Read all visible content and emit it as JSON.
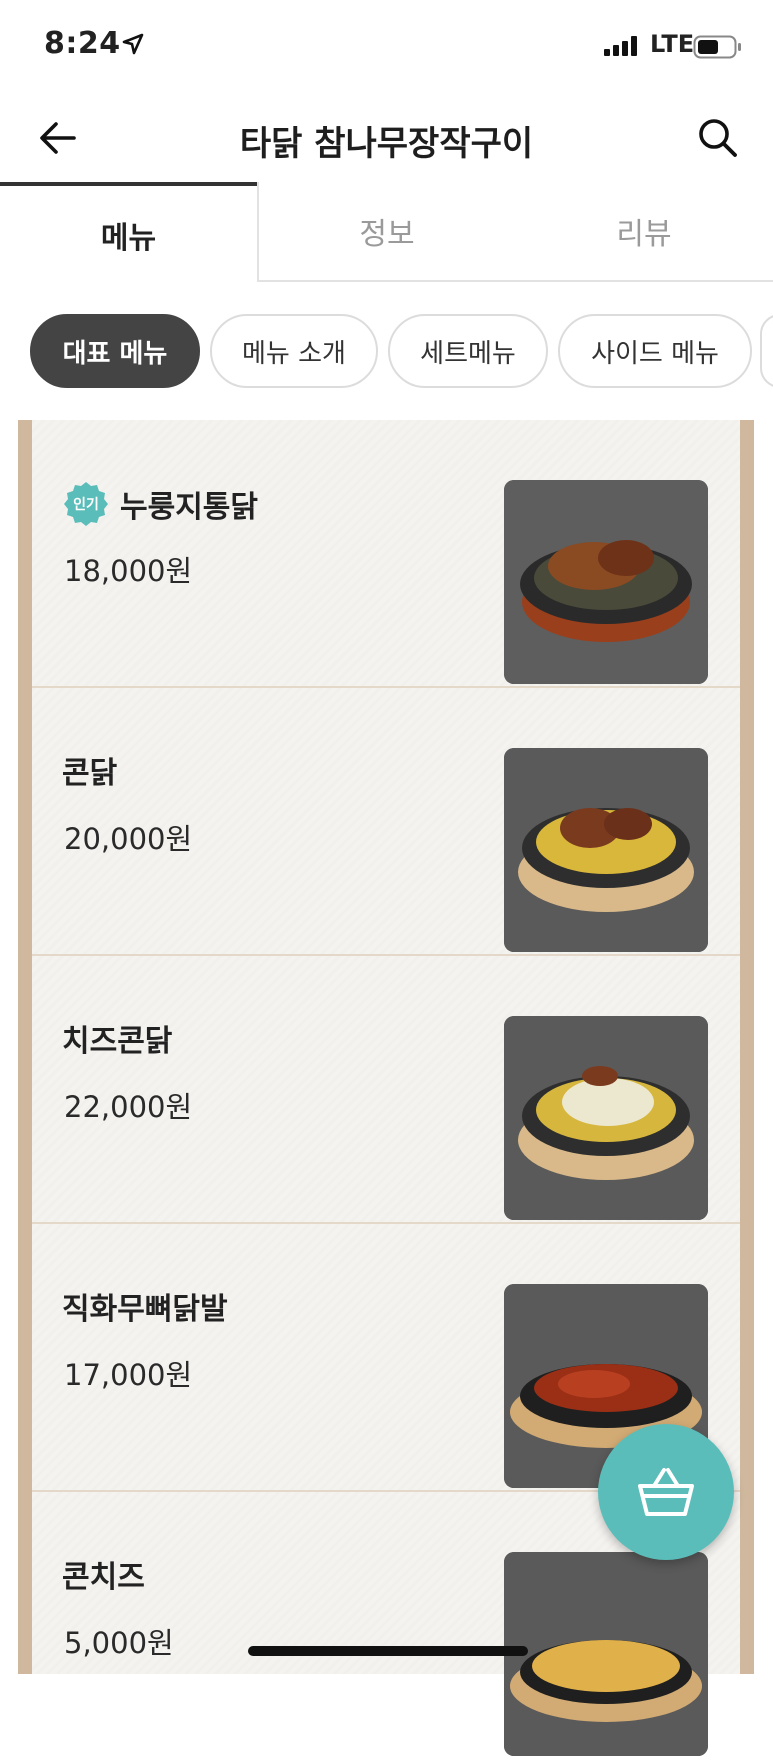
{
  "status": {
    "time": "8:24",
    "carrier": "LTE"
  },
  "header": {
    "title": "타닭 참나무장작구이"
  },
  "tabs": [
    {
      "label": "메뉴"
    },
    {
      "label": "정보"
    },
    {
      "label": "리뷰"
    }
  ],
  "chips": [
    {
      "label": "대표 메뉴",
      "active": true
    },
    {
      "label": "메뉴 소개"
    },
    {
      "label": "세트메뉴"
    },
    {
      "label": "사이드 메뉴"
    }
  ],
  "menu": {
    "badge_label": "인기",
    "items": [
      {
        "name": "누룽지통닭",
        "price": "18,000원",
        "badge": true
      },
      {
        "name": "콘닭",
        "price": "20,000원"
      },
      {
        "name": "치즈콘닭",
        "price": "22,000원"
      },
      {
        "name": "직화무뼈닭발",
        "price": "17,000원"
      },
      {
        "name": "콘치즈",
        "price": "5,000원"
      }
    ]
  },
  "icons": {
    "back": "arrow-left-icon",
    "search": "search-icon",
    "cart": "basket-icon",
    "location": "location-arrow-icon"
  },
  "colors": {
    "accent": "#5bbdb9",
    "chip_active": "#444444",
    "frame": "#cfb89d"
  }
}
